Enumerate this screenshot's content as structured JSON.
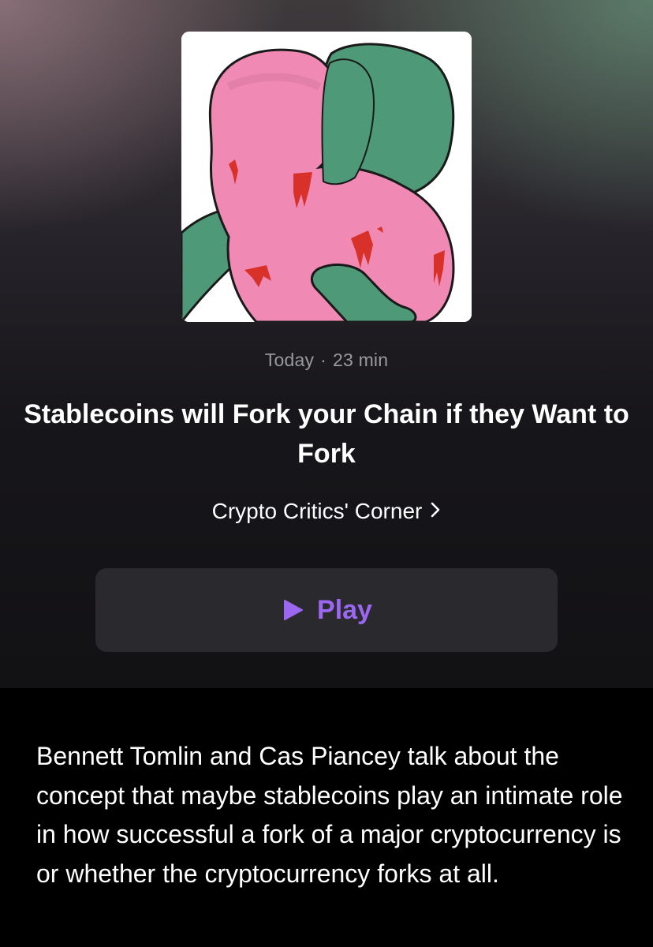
{
  "episode": {
    "date": "Today",
    "separator": "·",
    "duration": "23 min",
    "title": "Stablecoins will Fork your Chain if they Want to Fork",
    "show_name": "Crypto Critics' Corner",
    "artwork_icon": "artwork-hugging-figures-illustration"
  },
  "actions": {
    "play_label": "Play",
    "play_icon": "play-icon",
    "accent_color": "#9c67f0"
  },
  "description": "Bennett Tomlin and Cas Piancey talk about the concept that maybe stablecoins play an intimate role in how successful a fork of a major cryptocurrency is or whether the cryptocurrency forks at all."
}
